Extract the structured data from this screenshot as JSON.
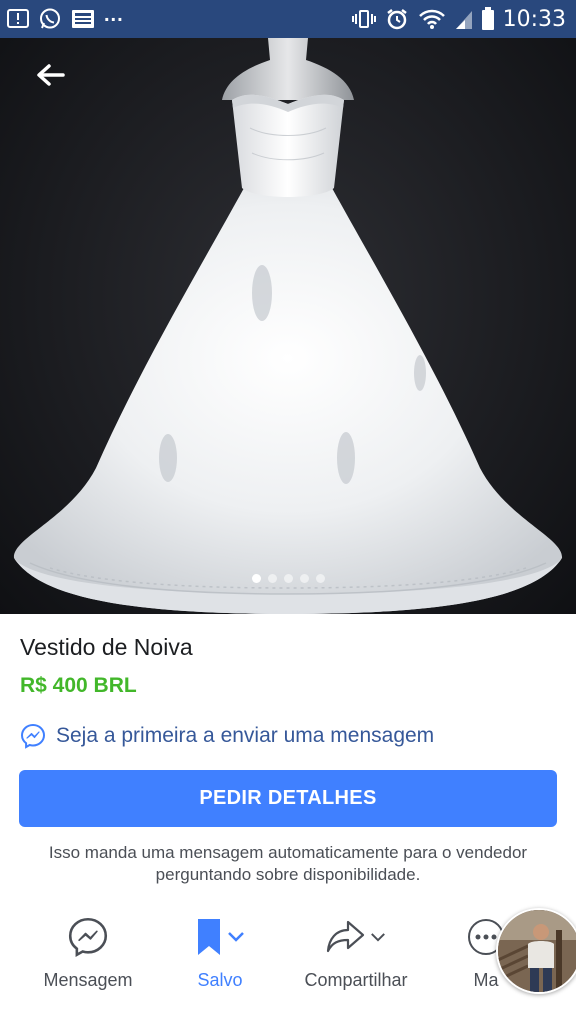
{
  "status_bar": {
    "time": "10:33",
    "overflow": "...",
    "left_icons": [
      "alert-icon",
      "whatsapp-icon",
      "news-icon"
    ],
    "right_icons": [
      "vibrate-icon",
      "alarm-icon",
      "wifi-icon",
      "signal-icon",
      "battery-icon"
    ],
    "background": "#29487d"
  },
  "hero": {
    "photo_count": 5,
    "active_photo_index": 0
  },
  "listing": {
    "title": "Vestido de Noiva",
    "price": "R$ 400 BRL",
    "message_prompt": "Seja a primeira a enviar uma mensagem"
  },
  "cta": {
    "label": "PEDIR DETALHES",
    "note": "Isso manda uma mensagem automaticamente para o vendedor perguntando sobre disponibilidade.",
    "color": "#4080ff"
  },
  "actions": {
    "message": "Mensagem",
    "saved": "Salvo",
    "share": "Compartilhar",
    "more": "Ma"
  },
  "colors": {
    "price": "#42b72a",
    "link": "#365899",
    "accent": "#4080ff"
  }
}
